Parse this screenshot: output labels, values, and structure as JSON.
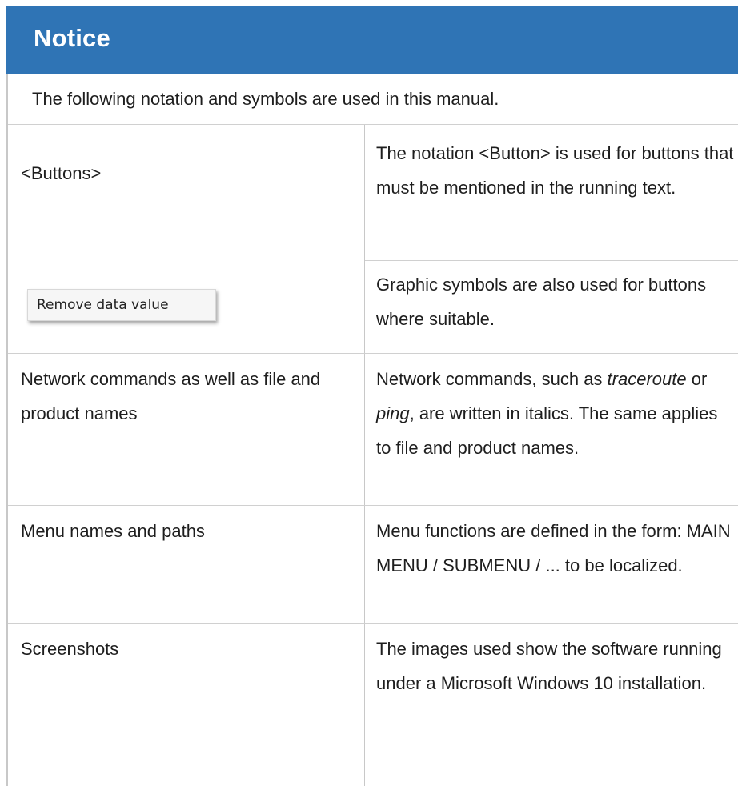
{
  "notice": {
    "title": "Notice",
    "intro": "The following notation and symbols are used in this manual."
  },
  "rows": [
    {
      "left": "<Buttons>",
      "right": "The notation <Button> is used for buttons that must be mentioned in the running text."
    },
    {
      "left_button": "Remove data value",
      "right": "Graphic symbols are also used for buttons where suitable."
    },
    {
      "left": "Network commands as well as file and product names",
      "right_parts": {
        "p1": "Network commands, such as ",
        "em1": "traceroute",
        "p2": " or ",
        "em2": "ping",
        "p3": ", are written in italics. The same applies to file and product names."
      }
    },
    {
      "left": "Menu names and paths",
      "right": "Menu functions are defined in the form: MAIN MENU / SUBMENU / ... to be localized."
    },
    {
      "left": "Screenshots",
      "right": "The images used show the software running under a Microsoft Windows 10 installation."
    }
  ],
  "colors": {
    "header_bg": "#2f74b5",
    "header_text": "#ffffff",
    "border": "#c8c8c8"
  }
}
